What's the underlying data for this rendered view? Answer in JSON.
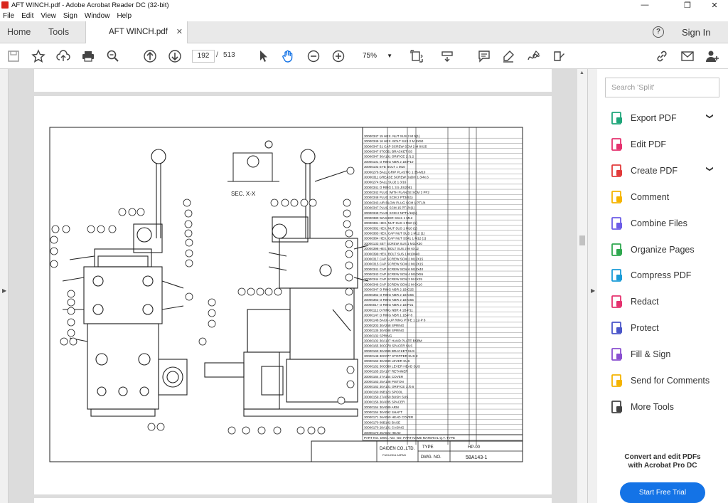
{
  "window": {
    "title": "AFT WINCH.pdf - Adobe Acrobat Reader DC (32-bit)",
    "minimize": "—",
    "restore": "❐",
    "close": "✕"
  },
  "menu": [
    "File",
    "Edit",
    "View",
    "Sign",
    "Window",
    "Help"
  ],
  "tabs": {
    "home": "Home",
    "tools": "Tools",
    "document": "AFT WINCH.pdf",
    "close": "✕"
  },
  "account": {
    "help": "?",
    "signin": "Sign In"
  },
  "toolbar": {
    "page_current": "192",
    "page_sep": "/",
    "page_total": "513",
    "zoom": "75%"
  },
  "right_pane": {
    "search_placeholder": "Search 'Split'",
    "tools": [
      {
        "label": "Export PDF",
        "color": "#1fa67a",
        "expandable": true
      },
      {
        "label": "Edit PDF",
        "color": "#e5326f",
        "expandable": false
      },
      {
        "label": "Create PDF",
        "color": "#e23b3b",
        "expandable": true
      },
      {
        "label": "Comment",
        "color": "#f5b400",
        "expandable": false
      },
      {
        "label": "Combine Files",
        "color": "#6c5ce7",
        "expandable": false
      },
      {
        "label": "Organize Pages",
        "color": "#2fa84f",
        "expandable": false
      },
      {
        "label": "Compress PDF",
        "color": "#1a9bd7",
        "expandable": false
      },
      {
        "label": "Redact",
        "color": "#e5326f",
        "expandable": false
      },
      {
        "label": "Protect",
        "color": "#4a56c9",
        "expandable": false
      },
      {
        "label": "Fill & Sign",
        "color": "#8a4fd0",
        "expandable": false
      },
      {
        "label": "Send for Comments",
        "color": "#f5b400",
        "expandable": false
      },
      {
        "label": "More Tools",
        "color": "#444444",
        "expandable": false
      }
    ],
    "promo_line1": "Convert and edit PDFs",
    "promo_line2": "with Acrobat Pro DC",
    "trial_button": "Start Free Trial"
  },
  "drawing": {
    "section_label": "SEC. X-X",
    "title_block": {
      "company": "DAIDEN CO.,LTD.",
      "location": "FUKUOKA JAPAN",
      "type_label": "TYPE",
      "type_value": "HP-00",
      "dwg_label": "DWG. NO.",
      "dwg_value": "58A143-1",
      "parts_header": "PART NO. DWG. NO. NO. PART NAME MATERIAL Q.T. TYPE"
    },
    "parts": [
      "30000347 15 HEX. NUT SUS 2 M 5(1)",
      "30000349 16 HEX. BOLT SUS 2 M 5X50",
      "30000347 51 CAP SCREW SCM 2 M 8X25",
      "30000347 07C051 BRACKET SS",
      "30000347 30A191 ORIFICE 2 /1.2",
      "30000101 O RING NBR 2 1B-P10",
      "30000102 EYE BOLT 1 M10",
      "30000276 BALL GRIP PLASTIC 1 35-M10",
      "30000311 GREASE SCREW DuDm 1 3/4x.6",
      "30000274 BALL SUJ2 1 3/16",
      "30000341 O RING 1 3.5 JIS2051",
      "30000342 PLUG WITH FLANGE SCM 2 PF2",
      "30000348 PLUG SCM 2 PT3/8(1)",
      "30000343 AIR BLOW PLUG SCM 1 PT1/4",
      "30000347 PLUG SCM 15 PT1/4(1)",
      "30000349 PLUG SCM 2 NPT1/16(1)",
      "30000380 WASHER SS41 1 M12",
      "30000381 HEX. NUT SUS 1 M10 (1)",
      "30000382 HEX. NUT SUS 1 M10 (1)",
      "30000383 HEX. CAP NUT SUS 1 M12 (1)",
      "30000384 HEX. CAP NUT SS41 1 M12 (1)",
      "30000133 SET SCREW SUS 1 M10X30",
      "30000398 HEX. BOLT SUS 2 M 6X12",
      "30000399 HEX. BOLT SUS 1 M10X40",
      "30000317 CAP SCREW SCM 2 M12X15",
      "30000315 CAP SCREW SCM 2 M12X15",
      "30000341 CAP SCREW SCM 6 M12X40",
      "30000343 CAP SCREW SCM 4 M10X55",
      "30000344 CAP SCREW SCM 2 M 6X25",
      "30000346 CAP SCREW SCM 2 M 6X10",
      "30000347 O RING NBR 2 1B-G25",
      "30000362 O RING NBR 2 1B-G55",
      "30000363 O RING NBR 2 1B-G55",
      "30000017 O RING NBR 2 1B-P21",
      "30000112 O RING NBR 4 1B-P11",
      "30000147 O RING NBR 1 1B-P 8",
      "30000148 BACK-UP RING PTFE 1 12-P 8",
      "30000203 30A258 SPRING",
      "30000135 30A088 SPRING",
      "30000132 SPRING",
      "30000102 30A107 HAND PLATE BSBM",
      "30000165 30C078 SPACER SUS",
      "30000163 30A089 BRACKET SUS",
      "30000148 30C077 STOPPER SUS 2",
      "30000162 30A080 LEVER SUS",
      "30000162 30C080 LEVER HEAD SUS",
      "30000165 25A107 RETAINER",
      "30000164 27A154 COVER",
      "30000163 25A108 PISTON",
      "30000162 30A101 ORIFICE 1 /0.6",
      "30000160 09B123 SPOOL",
      "30000159 27A050 BUSH SUS",
      "30000156 30A085 SPACER",
      "30000154 30A089 ARM",
      "30000154 30A092 SHAFT",
      "30000171 26A050 HEAD COVER",
      "30000170 09B142 BASE",
      "30000170 28A101 CASING",
      "30000170 25A022 HEAD"
    ]
  }
}
